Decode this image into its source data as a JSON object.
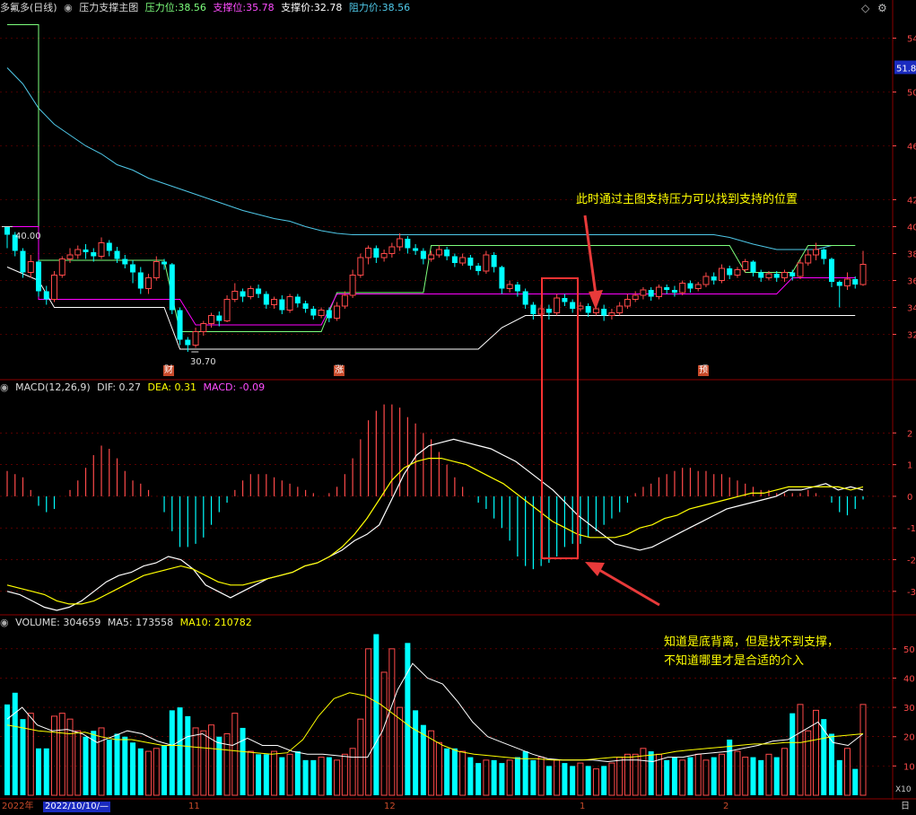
{
  "header": {
    "stock_name": "多氟多(日线)",
    "indicator_name": "压力支撑主图",
    "pressure_label": "压力位:",
    "pressure_value": "38.56",
    "support_label": "支撑位:",
    "support_value": "35.78",
    "support_price_label": "支撑价:",
    "support_price_value": "32.78",
    "resistance_label": "阻力价:",
    "resistance_value": "38.56"
  },
  "macd_header": {
    "label": "MACD(12,26,9)",
    "dif": "DIF: 0.27",
    "dea": "DEA: 0.31",
    "macd": "MACD: -0.09"
  },
  "volume_header": {
    "label": "VOLUME: 304659",
    "ma5": "MA5: 173558",
    "ma10": "MA10: 210782"
  },
  "annotations": {
    "support_note": "此时通过主图支持压力可以找到支持的位置",
    "divergence_line1": "知道是底背离，但是找不到支撑，",
    "divergence_line2": "不知道哪里才是合适的介入"
  },
  "markers": {
    "high_label": "40.00",
    "low_label": "30.70",
    "tag_cai": "财",
    "tag_zhang": "涨",
    "tag_yu": "预"
  },
  "axis": {
    "price_ticks": [
      "54",
      "50",
      "46",
      "42",
      "40",
      "38",
      "36",
      "34",
      "32"
    ],
    "price_badge": "51.8",
    "macd_ticks": [
      "2",
      "1",
      "0",
      "-1",
      "-2",
      "-3"
    ],
    "volume_ticks": [
      "50",
      "40",
      "30",
      "20",
      "10"
    ],
    "volume_unit": "X10",
    "date_labels": [
      "2022年",
      "2022/10/10/—",
      "11",
      "12",
      "1",
      "2"
    ],
    "corner": "日"
  },
  "colors": {
    "up": "#ff4a4a",
    "down": "#00ffff",
    "white": "#ffffff",
    "yellow": "#ffff00",
    "magenta": "#ff00ff",
    "green": "#7dff7d",
    "cyan_line": "#4fc8e8",
    "grid": "#8b0000",
    "highlight_box": "#ff3333"
  },
  "chart_data": [
    {
      "type": "candlestick",
      "title": "多氟多(日线) 压力支撑主图",
      "ylim": [
        29.5,
        55.5
      ],
      "candles": [
        [
          40.0,
          39.4,
          40.0,
          38.4
        ],
        [
          39.4,
          38.2,
          39.6,
          37.8
        ],
        [
          38.2,
          36.6,
          38.4,
          36.2
        ],
        [
          36.6,
          37.4,
          37.9,
          36.2
        ],
        [
          37.4,
          35.2,
          37.5,
          34.8
        ],
        [
          35.2,
          34.6,
          35.6,
          34.2
        ],
        [
          34.6,
          36.4,
          36.7,
          34.4
        ],
        [
          36.4,
          37.6,
          37.8,
          36.2
        ],
        [
          37.6,
          37.9,
          38.4,
          37.3
        ],
        [
          37.9,
          38.3,
          38.6,
          37.6
        ],
        [
          38.3,
          38.1,
          38.7,
          37.6
        ],
        [
          38.1,
          37.8,
          38.4,
          37.4
        ],
        [
          37.8,
          38.8,
          39.2,
          37.6
        ],
        [
          38.8,
          38.2,
          39.0,
          37.8
        ],
        [
          38.2,
          37.6,
          38.5,
          37.3
        ],
        [
          37.6,
          37.2,
          37.9,
          36.9
        ],
        [
          37.2,
          36.6,
          37.5,
          35.8
        ],
        [
          36.6,
          35.4,
          37.0,
          35.0
        ],
        [
          35.4,
          36.2,
          36.5,
          35.0
        ],
        [
          36.2,
          37.4,
          37.8,
          36.0
        ],
        [
          37.4,
          37.2,
          37.6,
          36.8
        ],
        [
          37.2,
          33.8,
          37.3,
          33.5
        ],
        [
          33.8,
          31.6,
          34.0,
          31.2
        ],
        [
          31.6,
          31.2,
          31.8,
          30.7
        ],
        [
          31.2,
          32.2,
          32.5,
          31.0
        ],
        [
          32.2,
          32.8,
          33.0,
          31.9
        ],
        [
          32.8,
          33.4,
          33.6,
          32.5
        ],
        [
          33.4,
          33.0,
          33.7,
          32.6
        ],
        [
          33.0,
          34.6,
          34.9,
          32.9
        ],
        [
          34.6,
          35.2,
          35.8,
          34.4
        ],
        [
          35.2,
          34.8,
          35.4,
          34.4
        ],
        [
          34.8,
          35.4,
          35.6,
          34.6
        ],
        [
          35.4,
          35.0,
          35.7,
          34.7
        ],
        [
          35.0,
          34.2,
          35.2,
          33.9
        ],
        [
          34.2,
          34.6,
          34.8,
          33.9
        ],
        [
          34.6,
          33.8,
          34.9,
          33.5
        ],
        [
          33.8,
          34.8,
          35.0,
          33.6
        ],
        [
          34.8,
          34.3,
          35.0,
          34.0
        ],
        [
          34.3,
          33.9,
          34.5,
          33.6
        ],
        [
          33.9,
          33.4,
          34.1,
          33.1
        ],
        [
          33.4,
          33.8,
          34.0,
          33.2
        ],
        [
          33.8,
          33.2,
          34.0,
          32.9
        ],
        [
          33.2,
          34.1,
          34.4,
          33.0
        ],
        [
          34.1,
          34.9,
          35.2,
          33.9
        ],
        [
          34.9,
          36.4,
          36.8,
          34.7
        ],
        [
          36.4,
          37.7,
          38.0,
          36.2
        ],
        [
          37.7,
          38.4,
          38.6,
          37.2
        ],
        [
          38.4,
          37.7,
          38.6,
          37.3
        ],
        [
          37.7,
          38.0,
          38.3,
          37.4
        ],
        [
          38.0,
          38.5,
          38.8,
          37.7
        ],
        [
          38.5,
          39.1,
          39.5,
          38.2
        ],
        [
          39.1,
          38.4,
          39.3,
          38.0
        ],
        [
          38.4,
          38.2,
          38.7,
          37.9
        ],
        [
          38.2,
          37.6,
          38.4,
          37.2
        ],
        [
          37.6,
          37.9,
          38.2,
          37.4
        ],
        [
          37.9,
          38.3,
          38.6,
          37.7
        ],
        [
          38.3,
          37.8,
          38.5,
          37.5
        ],
        [
          37.8,
          37.3,
          38.0,
          37.0
        ],
        [
          37.3,
          37.7,
          38.0,
          37.1
        ],
        [
          37.7,
          37.1,
          37.9,
          36.8
        ],
        [
          37.1,
          36.7,
          37.3,
          36.4
        ],
        [
          36.7,
          37.9,
          38.2,
          36.5
        ],
        [
          37.9,
          37.0,
          38.1,
          36.6
        ],
        [
          37.0,
          35.4,
          37.1,
          35.0
        ],
        [
          35.4,
          35.7,
          36.0,
          35.1
        ],
        [
          35.7,
          35.2,
          35.9,
          34.8
        ],
        [
          35.2,
          34.2,
          35.4,
          33.9
        ],
        [
          34.2,
          33.5,
          34.4,
          33.1
        ],
        [
          33.5,
          33.9,
          34.2,
          33.2
        ],
        [
          33.9,
          33.6,
          34.2,
          33.1
        ],
        [
          33.6,
          34.7,
          35.0,
          33.4
        ],
        [
          34.7,
          34.4,
          35.0,
          34.1
        ],
        [
          34.4,
          33.9,
          34.6,
          33.6
        ],
        [
          33.9,
          34.1,
          34.4,
          33.7
        ],
        [
          34.1,
          33.6,
          34.3,
          33.3
        ],
        [
          33.6,
          33.9,
          34.2,
          33.4
        ],
        [
          33.9,
          33.4,
          34.2,
          33.0
        ],
        [
          33.4,
          33.6,
          33.9,
          33.1
        ],
        [
          33.6,
          34.1,
          34.4,
          33.4
        ],
        [
          34.1,
          34.6,
          35.0,
          33.9
        ],
        [
          34.6,
          34.9,
          35.2,
          34.4
        ],
        [
          34.9,
          35.3,
          35.5,
          34.6
        ],
        [
          35.3,
          34.8,
          35.5,
          34.5
        ],
        [
          34.8,
          35.5,
          35.7,
          34.6
        ],
        [
          35.5,
          35.3,
          35.7,
          35.0
        ],
        [
          35.3,
          35.1,
          35.6,
          34.8
        ],
        [
          35.1,
          35.8,
          36.0,
          34.9
        ],
        [
          35.8,
          35.4,
          36.0,
          35.1
        ],
        [
          35.4,
          35.7,
          35.9,
          35.2
        ],
        [
          35.7,
          36.3,
          36.6,
          35.5
        ],
        [
          36.3,
          36.0,
          36.6,
          35.7
        ],
        [
          36.0,
          36.9,
          37.2,
          35.8
        ],
        [
          36.9,
          36.4,
          37.1,
          36.1
        ],
        [
          36.4,
          36.8,
          37.0,
          36.2
        ],
        [
          36.8,
          37.4,
          37.6,
          36.6
        ],
        [
          37.4,
          36.6,
          37.5,
          36.3
        ],
        [
          36.6,
          36.2,
          36.8,
          35.9
        ],
        [
          36.2,
          36.5,
          36.7,
          36.0
        ],
        [
          36.5,
          36.2,
          36.7,
          35.9
        ],
        [
          36.2,
          36.6,
          36.8,
          35.9
        ],
        [
          36.6,
          36.3,
          36.8,
          36.0
        ],
        [
          36.3,
          37.3,
          37.6,
          36.1
        ],
        [
          37.3,
          37.9,
          38.3,
          37.1
        ],
        [
          37.9,
          38.3,
          38.8,
          37.5
        ],
        [
          38.3,
          37.6,
          38.4,
          37.2
        ],
        [
          37.6,
          35.9,
          37.7,
          35.5
        ],
        [
          35.9,
          35.6,
          36.0,
          34.0
        ],
        [
          35.6,
          36.1,
          36.6,
          35.3
        ],
        [
          36.1,
          35.7,
          36.3,
          35.4
        ],
        [
          35.7,
          37.2,
          38.2,
          35.6
        ]
      ]
    },
    {
      "type": "bar",
      "title": "MACD(12,26,9)",
      "values": [
        0.8,
        0.7,
        0.6,
        0.2,
        -0.3,
        -0.5,
        -0.4,
        0.0,
        0.2,
        0.5,
        0.9,
        1.3,
        1.6,
        1.5,
        1.2,
        0.8,
        0.5,
        0.4,
        0.2,
        0.0,
        -0.5,
        -1.1,
        -1.6,
        -1.6,
        -1.5,
        -1.3,
        -0.9,
        -0.5,
        -0.2,
        0.2,
        0.5,
        0.7,
        0.7,
        0.7,
        0.6,
        0.5,
        0.4,
        0.3,
        0.2,
        0.1,
        0.0,
        0.1,
        0.3,
        0.7,
        1.2,
        1.8,
        2.4,
        2.7,
        2.9,
        2.9,
        2.8,
        2.5,
        2.3,
        2.0,
        1.8,
        1.4,
        1.0,
        0.6,
        0.3,
        0.0,
        -0.2,
        -0.4,
        -0.7,
        -1.0,
        -1.4,
        -1.9,
        -2.2,
        -2.3,
        -2.2,
        -2.1,
        -1.9,
        -1.6,
        -1.5,
        -1.5,
        -1.3,
        -1.1,
        -0.9,
        -0.7,
        -0.5,
        -0.2,
        0.1,
        0.3,
        0.4,
        0.6,
        0.7,
        0.8,
        0.9,
        0.9,
        0.8,
        0.8,
        0.7,
        0.7,
        0.6,
        0.5,
        0.4,
        0.3,
        0.2,
        0.2,
        0.1,
        0.1,
        0.1,
        0.1,
        0.2,
        0.1,
        0.0,
        -0.2,
        -0.5,
        -0.6,
        -0.4,
        -0.1
      ],
      "dif": [
        -3.0,
        -3.1,
        -3.3,
        -3.5,
        -3.6,
        -3.5,
        -3.3,
        -3.0,
        -2.7,
        -2.5,
        -2.4,
        -2.2,
        -2.1,
        -1.9,
        -2.0,
        -2.3,
        -2.8,
        -3.0,
        -3.2,
        -3.0,
        -2.8,
        -2.6,
        -2.5,
        -2.4,
        -2.2,
        -2.1,
        -1.9,
        -1.7,
        -1.4,
        -1.2,
        -0.9,
        -0.1,
        0.7,
        1.3,
        1.6,
        1.7,
        1.8,
        1.7,
        1.6,
        1.5,
        1.3,
        1.1,
        0.8,
        0.5,
        0.2,
        -0.2,
        -0.6,
        -0.9,
        -1.2,
        -1.5,
        -1.6,
        -1.7,
        -1.6,
        -1.4,
        -1.2,
        -1.0,
        -0.8,
        -0.6,
        -0.4,
        -0.3,
        -0.2,
        -0.1,
        0.0,
        0.2,
        0.2,
        0.3,
        0.4,
        0.2,
        0.3,
        0.2
      ],
      "dea": [
        -2.8,
        -2.9,
        -3.0,
        -3.1,
        -3.3,
        -3.4,
        -3.4,
        -3.3,
        -3.1,
        -2.9,
        -2.7,
        -2.5,
        -2.4,
        -2.3,
        -2.2,
        -2.3,
        -2.5,
        -2.7,
        -2.8,
        -2.8,
        -2.7,
        -2.6,
        -2.5,
        -2.4,
        -2.2,
        -2.1,
        -1.9,
        -1.6,
        -1.2,
        -0.7,
        -0.1,
        0.5,
        0.9,
        1.1,
        1.2,
        1.2,
        1.1,
        1.0,
        0.8,
        0.6,
        0.4,
        0.1,
        -0.2,
        -0.5,
        -0.8,
        -1.0,
        -1.2,
        -1.3,
        -1.3,
        -1.3,
        -1.2,
        -1.0,
        -0.9,
        -0.7,
        -0.6,
        -0.4,
        -0.3,
        -0.2,
        -0.1,
        0.0,
        0.1,
        0.1,
        0.2,
        0.3,
        0.3,
        0.3,
        0.3,
        0.3,
        0.2,
        0.3
      ]
    },
    {
      "type": "bar",
      "title": "VOLUME",
      "values": [
        31,
        35,
        26,
        28,
        16,
        16,
        27,
        28,
        26,
        22,
        20,
        22,
        23,
        19,
        21,
        20,
        18,
        16,
        15,
        16,
        17,
        29,
        30,
        27,
        23,
        22,
        24,
        20,
        21,
        28,
        23,
        15,
        14,
        14,
        15,
        13,
        14,
        15,
        12,
        12,
        13,
        13,
        12,
        14,
        16,
        26,
        50,
        55,
        42,
        50,
        30,
        52,
        29,
        24,
        22,
        18,
        16,
        16,
        15,
        13,
        11,
        12,
        12,
        11,
        12,
        13,
        15,
        12,
        13,
        10,
        12,
        11,
        10,
        11,
        10,
        9,
        10,
        11,
        13,
        14,
        14,
        16,
        15,
        14,
        12,
        13,
        12,
        13,
        14,
        12,
        13,
        14,
        19,
        15,
        13,
        13,
        12,
        14,
        13,
        16,
        28,
        31,
        22,
        29,
        26,
        21,
        12,
        16,
        9,
        31
      ],
      "ma5": [
        26.0,
        30.0,
        24.0,
        22.0,
        22.5,
        21.0,
        18.0,
        20.0,
        22.0,
        21.0,
        18.5,
        17.0,
        20.0,
        21.0,
        18.0,
        17.0,
        19.5,
        17.0,
        17.0,
        15.0,
        14.0,
        14.0,
        13.5,
        13.0,
        13.0,
        22.0,
        36.0,
        45.0,
        40.0,
        38.0,
        32.0,
        25.0,
        20.0,
        18.0,
        16.0,
        14.0,
        12.5,
        12.0,
        12.0,
        12.0,
        11.5,
        12.0,
        12.0,
        11.5,
        13.0,
        13.0,
        14.0,
        14.5,
        15.0,
        16.0,
        17.0,
        18.5,
        19.0,
        22.0,
        25.0,
        18.0,
        17.0,
        21.0
      ],
      "ma10": [
        24.0,
        23.0,
        22.0,
        21.5,
        21.0,
        21.5,
        20.0,
        19.0,
        19.0,
        18.0,
        17.0,
        17.0,
        16.5,
        16.0,
        15.5,
        15.0,
        14.5,
        14.0,
        14.5,
        19.0,
        27.0,
        33.0,
        35.0,
        34.0,
        31.0,
        27.0,
        23.0,
        20.0,
        17.0,
        15.0,
        14.0,
        13.5,
        13.0,
        12.5,
        12.5,
        12.0,
        12.0,
        12.0,
        12.5,
        13.0,
        13.0,
        13.5,
        14.0,
        15.0,
        15.5,
        16.0,
        16.5,
        17.0,
        17.5,
        17.5,
        18.0,
        18.0,
        19.0,
        20.0,
        20.5,
        21.0
      ]
    }
  ]
}
